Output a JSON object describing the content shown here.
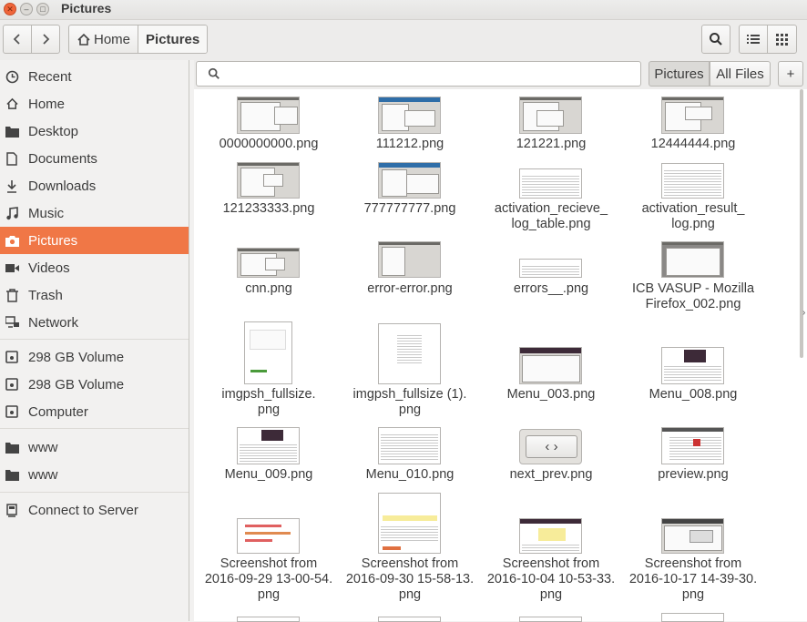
{
  "window": {
    "title": "Pictures"
  },
  "toolbar": {
    "home_label": "Home",
    "current_label": "Pictures"
  },
  "sidebar": {
    "items": [
      {
        "label": "Recent",
        "icon": "clock-icon"
      },
      {
        "label": "Home",
        "icon": "home-icon"
      },
      {
        "label": "Desktop",
        "icon": "folder-icon"
      },
      {
        "label": "Documents",
        "icon": "document-icon"
      },
      {
        "label": "Downloads",
        "icon": "download-icon"
      },
      {
        "label": "Music",
        "icon": "music-icon"
      },
      {
        "label": "Pictures",
        "icon": "camera-icon",
        "selected": true
      },
      {
        "label": "Videos",
        "icon": "video-icon"
      },
      {
        "label": "Trash",
        "icon": "trash-icon"
      },
      {
        "label": "Network",
        "icon": "network-icon"
      }
    ],
    "devices": [
      {
        "label": "298 GB Volume",
        "icon": "drive-icon"
      },
      {
        "label": "298 GB Volume",
        "icon": "drive-icon"
      },
      {
        "label": "Computer",
        "icon": "drive-icon"
      }
    ],
    "bookmarks": [
      {
        "label": "www",
        "icon": "folder-icon"
      },
      {
        "label": "www",
        "icon": "folder-icon"
      }
    ],
    "connect_label": "Connect to Server"
  },
  "filter": {
    "search_placeholder": "",
    "pictures_label": "Pictures",
    "all_files_label": "All Files",
    "add_label": "+"
  },
  "files": [
    {
      "name": "0000000000.png"
    },
    {
      "name": "111212.png"
    },
    {
      "name": "121221.png"
    },
    {
      "name": "12444444.png"
    },
    {
      "name": "121233333.png"
    },
    {
      "name": "777777777.png"
    },
    {
      "name": "activation_recieve_ log_table.png"
    },
    {
      "name": "activation_result_ log.png"
    },
    {
      "name": "cnn.png"
    },
    {
      "name": "error-error.png"
    },
    {
      "name": "errors__.png"
    },
    {
      "name": "ICB VASUP - Mozilla Firefox_002.png"
    },
    {
      "name": "imgpsh_fullsize. png"
    },
    {
      "name": "imgpsh_fullsize (1). png"
    },
    {
      "name": "Menu_003.png"
    },
    {
      "name": "Menu_008.png"
    },
    {
      "name": "Menu_009.png"
    },
    {
      "name": "Menu_010.png"
    },
    {
      "name": "next_prev.png"
    },
    {
      "name": "preview.png"
    },
    {
      "name": "Screenshot from 2016-09-29 13-00-54. png"
    },
    {
      "name": "Screenshot from 2016-09-30 15-58-13. png"
    },
    {
      "name": "Screenshot from 2016-10-04 10-53-33. png"
    },
    {
      "name": "Screenshot from 2016-10-17 14-39-30. png"
    }
  ],
  "colors": {
    "accent": "#f07746",
    "background": "#f2f1f0"
  }
}
